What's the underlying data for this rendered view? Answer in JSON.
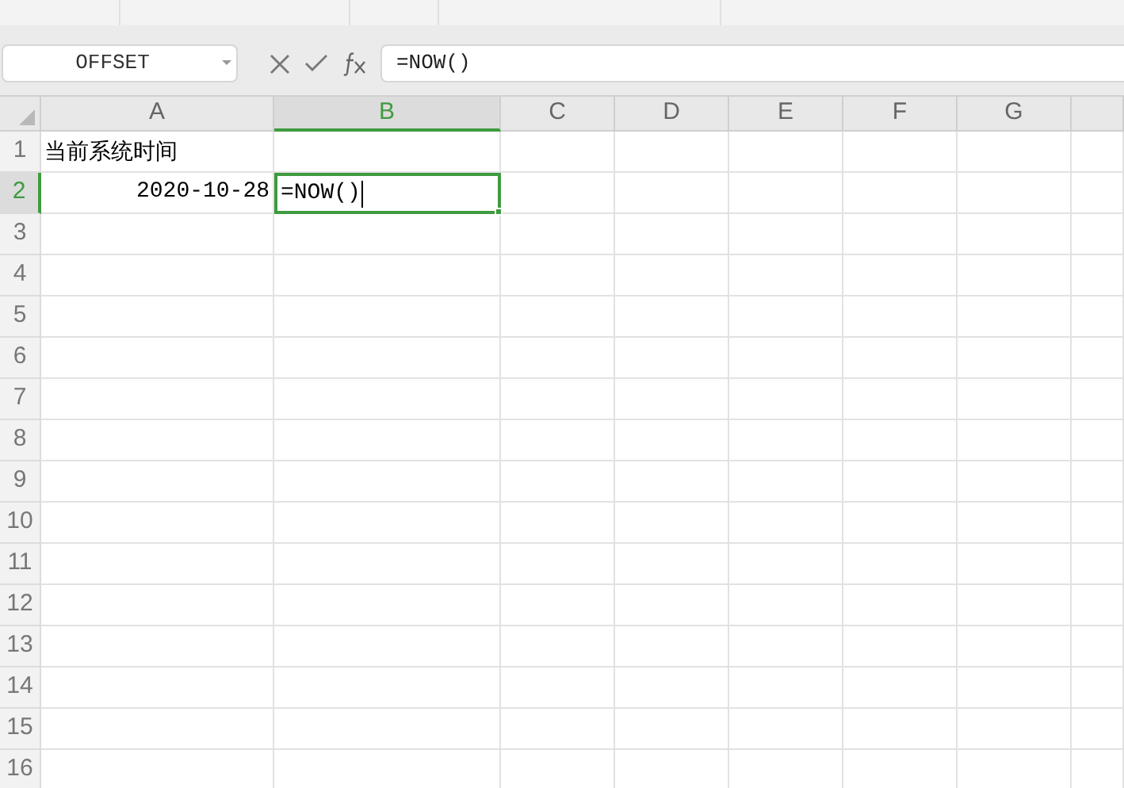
{
  "name_box": {
    "value": "OFFSET"
  },
  "formula_bar": {
    "value": "=NOW()"
  },
  "columns": [
    {
      "label": "A",
      "selected": false
    },
    {
      "label": "B",
      "selected": true
    },
    {
      "label": "C",
      "selected": false
    },
    {
      "label": "D",
      "selected": false
    },
    {
      "label": "E",
      "selected": false
    },
    {
      "label": "F",
      "selected": false
    },
    {
      "label": "G",
      "selected": false
    },
    {
      "selected": false
    }
  ],
  "rows": [
    {
      "label": "1",
      "selected": false,
      "cells": [
        {
          "text": "当前系统时间",
          "kind": "text",
          "selected": false
        }
      ]
    },
    {
      "label": "2",
      "selected": true,
      "cells": [
        {
          "text": "2020-10-28",
          "kind": "number",
          "selected": false
        },
        {
          "text": "=NOW()",
          "kind": "text",
          "selected": true
        }
      ]
    },
    {
      "label": "3",
      "selected": false,
      "cells": []
    },
    {
      "label": "4",
      "selected": false,
      "cells": []
    },
    {
      "label": "5",
      "selected": false,
      "cells": []
    },
    {
      "label": "6",
      "selected": false,
      "cells": []
    },
    {
      "label": "7",
      "selected": false,
      "cells": []
    },
    {
      "label": "8",
      "selected": false,
      "cells": []
    },
    {
      "label": "9",
      "selected": false,
      "cells": []
    },
    {
      "label": "10",
      "selected": false,
      "cells": []
    },
    {
      "label": "11",
      "selected": false,
      "cells": []
    },
    {
      "label": "12",
      "selected": false,
      "cells": []
    },
    {
      "label": "13",
      "selected": false,
      "cells": []
    },
    {
      "label": "14",
      "selected": false,
      "cells": []
    },
    {
      "label": "15",
      "selected": false,
      "cells": []
    },
    {
      "label": "16",
      "selected": false,
      "cells": []
    }
  ]
}
